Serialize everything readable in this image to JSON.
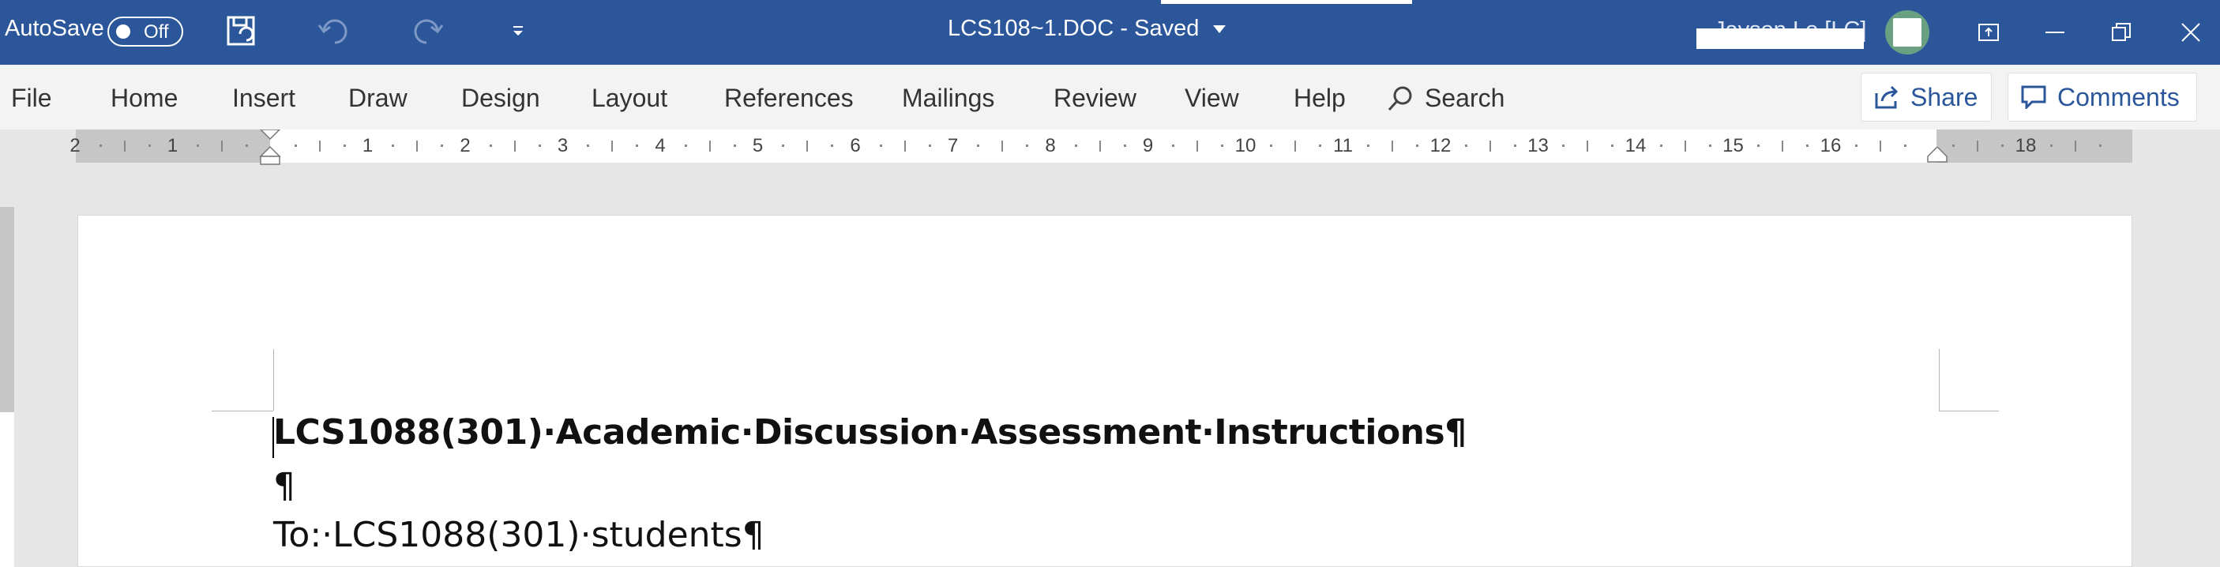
{
  "titlebar": {
    "autosave_label": "AutoSave",
    "autosave_state": "Off",
    "doc_title": "LCS108~1.DOC  -  Saved",
    "user_name": "Jayson Lo [LC]"
  },
  "ribbon": {
    "tabs": [
      "File",
      "Home",
      "Insert",
      "Draw",
      "Design",
      "Layout",
      "References",
      "Mailings",
      "Review",
      "View",
      "Help"
    ],
    "search_label": "Search",
    "share_label": "Share",
    "comments_label": "Comments"
  },
  "ruler": {
    "labels": [
      "2",
      "1",
      "1",
      "2",
      "3",
      "4",
      "5",
      "6",
      "7",
      "8",
      "9",
      "10",
      "11",
      "12",
      "13",
      "14",
      "15",
      "16",
      "18"
    ]
  },
  "document": {
    "line1": "LCS1088(301)·Academic·Discussion·Assessment·Instructions¶",
    "line2": "¶",
    "line3": "To:·LCS1088(301)·students¶"
  },
  "colors": {
    "titlebar": "#2b579a",
    "ribbon": "#f3f3f3",
    "accent": "#2b579a"
  }
}
